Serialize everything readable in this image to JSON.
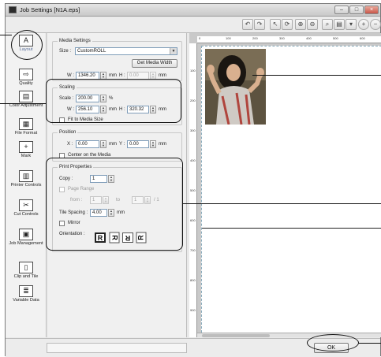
{
  "window": {
    "title": "Job Settings [N1A.eps]",
    "title_buttons": [
      "–",
      "□",
      "×"
    ]
  },
  "toolbar": {
    "icons": [
      "undo-icon",
      "redo-icon",
      "arrow-pointer-icon",
      "rotate-icon",
      "zoom-in-icon",
      "zoom-out-icon",
      "fit-page-icon",
      "print-setup-icon",
      "layout-options-icon",
      "zoom-plus-icon",
      "zoom-minus-icon"
    ]
  },
  "sidebar": {
    "items": [
      {
        "label": "Layout",
        "icon": "layout-icon",
        "glyph": "A"
      },
      {
        "label": "Quality",
        "icon": "quality-icon",
        "glyph": "⇨"
      },
      {
        "label": "Color Adjustment",
        "icon": "color-adjustment-icon",
        "glyph": "▤"
      },
      {
        "label": "File Format",
        "icon": "file-format-icon",
        "glyph": "▦"
      },
      {
        "label": "Mark",
        "icon": "mark-icon",
        "glyph": "+"
      },
      {
        "label": "Printer Controls",
        "icon": "printer-controls-icon",
        "glyph": "▥"
      },
      {
        "label": "Cut Controls",
        "icon": "cut-controls-icon",
        "glyph": "✂"
      },
      {
        "label": "Job Management",
        "icon": "job-management-icon",
        "glyph": "▣"
      },
      {
        "label": "Clip and Tile",
        "icon": "clip-tile-icon",
        "glyph": "▯"
      },
      {
        "label": "Variable Data",
        "icon": "variable-data-icon",
        "glyph": "≣"
      }
    ]
  },
  "media": {
    "title": "Media Settings",
    "size_label": "Size :",
    "size_value": "CustomROLL",
    "get_width_button": "Get Media Width",
    "w_label": "W :",
    "w_value": "1346.20",
    "w_unit": "mm",
    "h_label": "H :",
    "h_value": "0.00",
    "h_unit": "mm"
  },
  "scaling": {
    "title": "Scaling",
    "scale_label": "Scale :",
    "scale_value": "200.00",
    "scale_unit": "%",
    "w_label": "W :",
    "w_value": "256.10",
    "w_unit": "mm",
    "h_label": "H :",
    "h_value": "320.32",
    "h_unit": "mm",
    "fit_label": "Fit to Media Size"
  },
  "position": {
    "title": "Position",
    "x_label": "X :",
    "x_value": "0.00",
    "x_unit": "mm",
    "y_label": "Y :",
    "y_value": "0.00",
    "y_unit": "mm",
    "center_label": "Center on the Media"
  },
  "print": {
    "title": "Print Properties",
    "copy_label": "Copy :",
    "copy_value": "1",
    "page_range_label": "Page Range",
    "from_label": "from :",
    "from_value": "1",
    "to_label": "to",
    "to_value": "1",
    "to_total": "/ 1",
    "tile_spacing_label": "Tile Spacing :",
    "tile_spacing_value": "4.00",
    "tile_spacing_unit": "mm",
    "mirror_label": "Mirror",
    "orientation_label": "Orientation :",
    "orientations": [
      "R",
      "R",
      "R",
      "R"
    ]
  },
  "ruler": {
    "ticks": [
      "0",
      "100",
      "200",
      "300",
      "400",
      "500",
      "600"
    ],
    "vticks": [
      "100",
      "200",
      "300",
      "400",
      "500",
      "600",
      "700",
      "800",
      "900"
    ]
  },
  "footer": {
    "ok_label": "OK"
  }
}
